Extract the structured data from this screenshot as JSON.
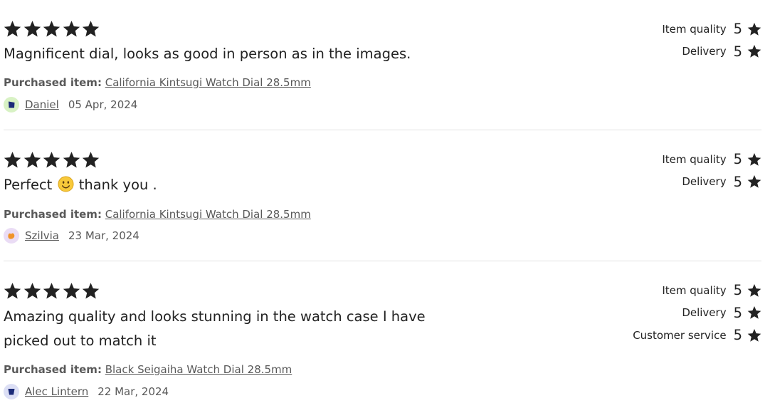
{
  "colors": {
    "star": "#222222",
    "divider": "#e1e1e1",
    "muted_text": "#595959"
  },
  "purchased_label": "Purchased item:",
  "reviews": [
    {
      "stars": 5,
      "text": "Magnificent dial, looks as good in person as in the images.",
      "item": "California Kintsugi Watch Dial 28.5mm",
      "reviewer": "Daniel",
      "date": "05 Apr, 2024",
      "avatar_bg": "#d8f2c4",
      "avatar_color": "#1b2a78",
      "ratings": [
        {
          "label": "Item quality",
          "value": "5"
        },
        {
          "label": "Delivery",
          "value": "5"
        }
      ]
    },
    {
      "stars": 5,
      "text_before": "Perfect",
      "emoji": "slightly-smiling-face",
      "text_after": "thank you .",
      "item": "California Kintsugi Watch Dial 28.5mm",
      "reviewer": "Szilvia",
      "date": "23 Mar, 2024",
      "avatar_bg": "#eadcf5",
      "avatar_color": "#f0932a",
      "ratings": [
        {
          "label": "Item quality",
          "value": "5"
        },
        {
          "label": "Delivery",
          "value": "5"
        }
      ]
    },
    {
      "stars": 5,
      "text": "Amazing quality and looks stunning in the watch case I have picked out to match it",
      "item": "Black Seigaiha Watch Dial 28.5mm",
      "reviewer": "Alec Lintern",
      "date": "22 Mar, 2024",
      "avatar_bg": "#dcdff5",
      "avatar_color": "#1b2a78",
      "ratings": [
        {
          "label": "Item quality",
          "value": "5"
        },
        {
          "label": "Delivery",
          "value": "5"
        },
        {
          "label": "Customer service",
          "value": "5"
        }
      ]
    }
  ]
}
